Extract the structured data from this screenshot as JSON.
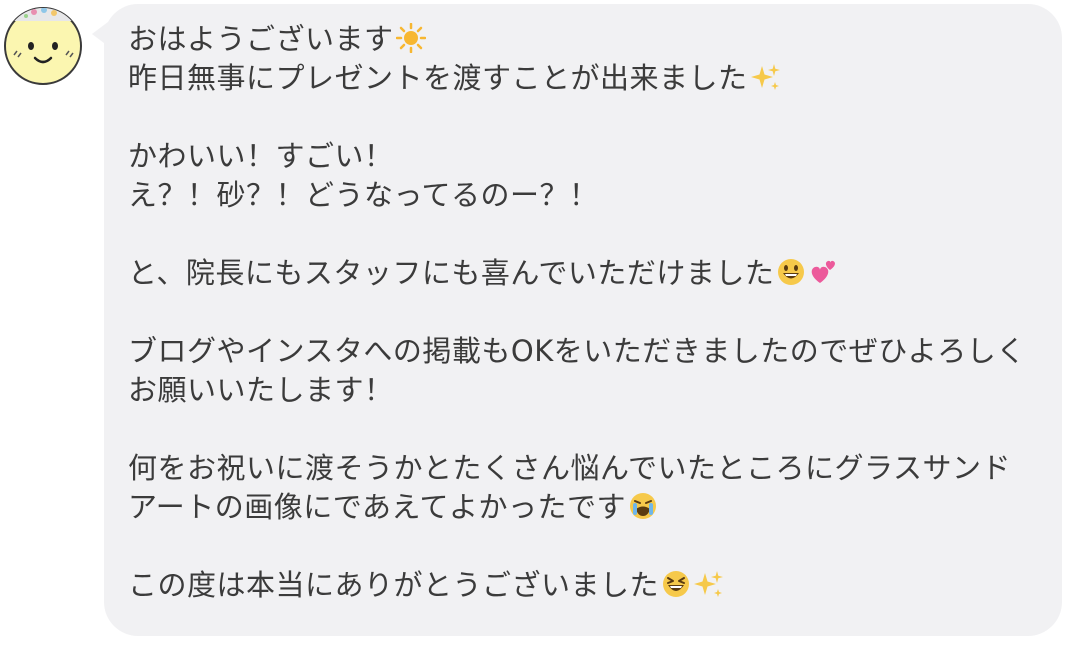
{
  "message": {
    "line1": "おはようございます",
    "line2": "昨日無事にプレゼントを渡すことが出来ました",
    "line3": "かわいい！すごい！",
    "line4": "え？！砂？！どうなってるのー？！",
    "line5": "と、院長にもスタッフにも喜んでいただけました",
    "line6": "ブログやインスタへの掲載もOKをいただきましたのでぜひよろしく",
    "line7": "お願いいたします！",
    "line8": "何をお祝いに渡そうかとたくさん悩んでいたところにグラスサンド",
    "line9": "アートの画像にであえてよかったです",
    "line10": "この度は本当にありがとうございました"
  },
  "colors": {
    "bubble": "#f1f1f3",
    "text": "#3b3b3b",
    "avatar_face": "#fbf6b0"
  },
  "icons": [
    "sun-emoji",
    "sparkles-emoji",
    "grinning-face-emoji",
    "two-hearts-emoji",
    "crying-face-emoji",
    "laughing-face-emoji"
  ]
}
